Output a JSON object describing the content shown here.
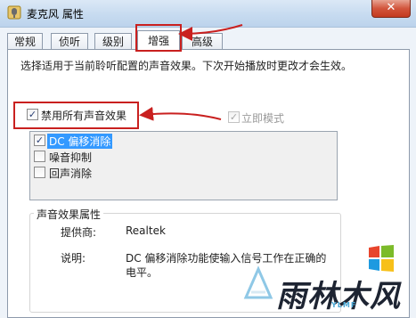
{
  "window": {
    "title": "麦克风 属性",
    "close_glyph": "✕"
  },
  "tabs": [
    {
      "label": "常规"
    },
    {
      "label": "侦听"
    },
    {
      "label": "级别"
    },
    {
      "label": "增强"
    },
    {
      "label": "高级"
    }
  ],
  "active_tab": "增强",
  "description": "选择适用于当前聆听配置的声音效果。下次开始播放时更改才会生效。",
  "disable_all": {
    "label": "禁用所有声音效果",
    "checked": true
  },
  "immediate_mode": {
    "label": "立即模式",
    "checked": true,
    "enabled": false
  },
  "effects": [
    {
      "label": "DC 偏移消除",
      "checked": true,
      "selected": true
    },
    {
      "label": "噪音抑制",
      "checked": false
    },
    {
      "label": "回声消除",
      "checked": false
    }
  ],
  "properties": {
    "title": "声音效果属性",
    "provider_key": "提供商:",
    "provider_value": "Realtek",
    "desc_key": "说明:",
    "desc_value_line1": "DC 偏移消除功能使输入信号工作在正确的",
    "desc_value_line2": "电平。"
  },
  "watermark": {
    "brand": "雨林木风",
    "sub": "YLMF"
  },
  "colors": {
    "highlight": "#c9201f",
    "selection": "#3399ff",
    "panel": "#ffffff"
  },
  "check_glyph": "✓"
}
